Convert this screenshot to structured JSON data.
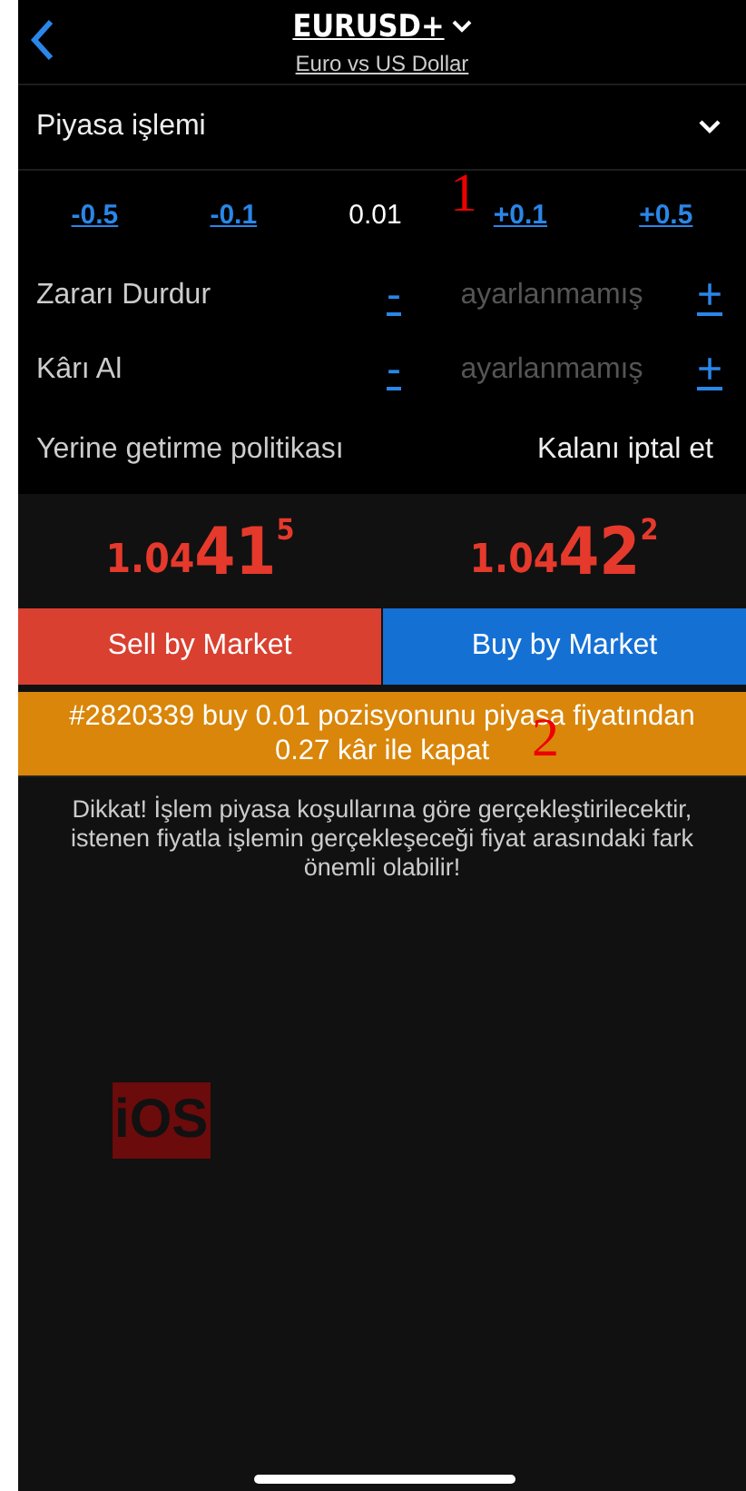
{
  "header": {
    "symbol": "EURUSD+",
    "description": "Euro vs US Dollar"
  },
  "order_type": {
    "value": "Piyasa işlemi"
  },
  "volume": {
    "steps": [
      {
        "label": "-0.5",
        "kind": "minus"
      },
      {
        "label": "-0.1",
        "kind": "minus"
      },
      {
        "label": "0.01",
        "kind": "value"
      },
      {
        "label": "+0.1",
        "kind": "plus"
      },
      {
        "label": "+0.5",
        "kind": "plus"
      }
    ]
  },
  "levels": [
    {
      "label": "Zararı Durdur",
      "minus": "-",
      "placeholder": "ayarlanmamış",
      "plus": "+"
    },
    {
      "label": "Kârı Al",
      "minus": "-",
      "placeholder": "ayarlanmamış",
      "plus": "+"
    }
  ],
  "policy": {
    "label": "Yerine getirme politikası",
    "value": "Kalanı iptal et"
  },
  "prices": [
    {
      "prefix": "1.04",
      "big": "41",
      "sup": "5"
    },
    {
      "prefix": "1.04",
      "big": "42",
      "sup": "2"
    }
  ],
  "buttons": [
    {
      "label": "Sell by Market",
      "kind": "sell"
    },
    {
      "label": "Buy by Market",
      "kind": "buy"
    }
  ],
  "close_banner": "#2820339 buy 0.01 pozisyonunu piyasa fiyatından 0.27 kâr ile kapat",
  "disclaimer": "Dikkat! İşlem piyasa koşullarına göre gerçekleştirilecektir, istenen fiyatla işlemin gerçekleşeceği fiyat arasındaki fark önemli olabilir!",
  "annotations": [
    {
      "text": "1",
      "kind": "number"
    },
    {
      "text": "2",
      "kind": "number"
    },
    {
      "text": "iOS",
      "kind": "tag"
    }
  ]
}
